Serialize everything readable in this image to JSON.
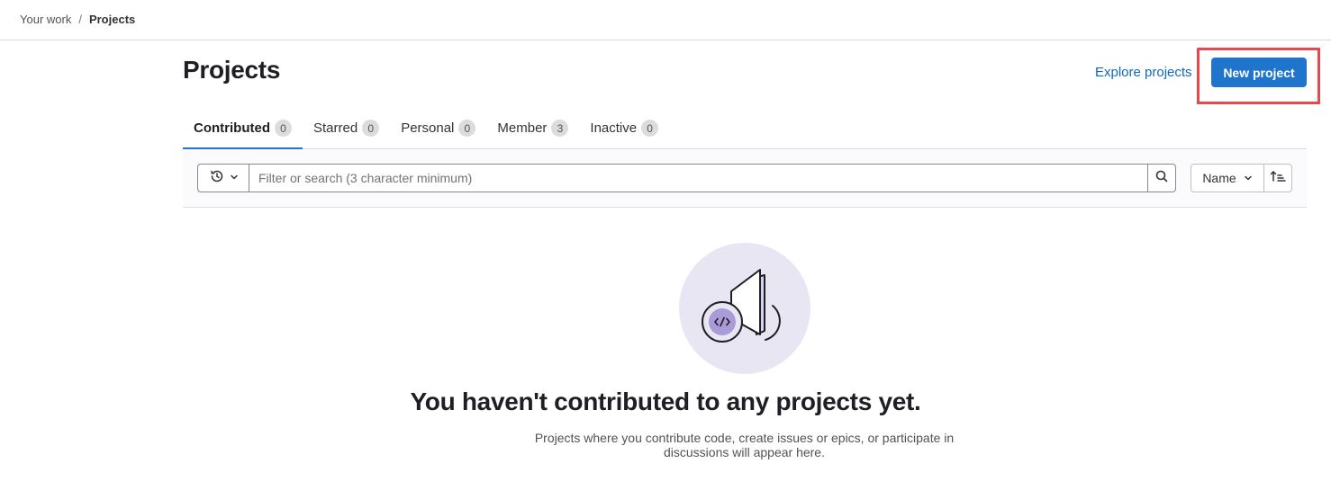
{
  "breadcrumb": {
    "items": [
      "Your work",
      "Projects"
    ],
    "separator": "/"
  },
  "header": {
    "title": "Projects",
    "explore_link": "Explore projects",
    "new_button": "New project"
  },
  "tabs": [
    {
      "label": "Contributed",
      "count": "0",
      "active": true
    },
    {
      "label": "Starred",
      "count": "0"
    },
    {
      "label": "Personal",
      "count": "0"
    },
    {
      "label": "Member",
      "count": "3"
    },
    {
      "label": "Inactive",
      "count": "0"
    }
  ],
  "filter": {
    "placeholder": "Filter or search (3 character minimum)",
    "sort_label": "Name",
    "history_icon": "history-icon",
    "search_icon": "search-icon",
    "sort_direction_icon": "sort-ascending-icon"
  },
  "empty_state": {
    "title": "You haven't contributed to any projects yet.",
    "description": "Projects where you contribute code, create issues or epics, or participate in discussions will appear here."
  },
  "colors": {
    "accent": "#1f75cb",
    "link": "#1068bf",
    "highlight": "#e5484d",
    "illustration_bg": "#e9e6f4",
    "illustration_accent": "#a99ad8"
  }
}
